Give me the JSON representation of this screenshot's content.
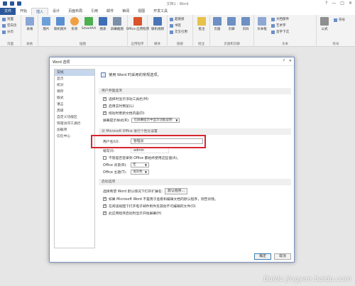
{
  "window": {
    "title": "文档1 - Word",
    "controls": [
      "?",
      "—",
      "□",
      "✕"
    ]
  },
  "ribbon": {
    "tabs": [
      "文件",
      "开始",
      "插入",
      "设计",
      "页面布局",
      "引用",
      "邮件",
      "审阅",
      "视图",
      "开发工具"
    ],
    "active_tab": "插入",
    "groups": [
      {
        "label": "页面",
        "buttons": []
      },
      {
        "label": "表格",
        "buttons": [
          "表格"
        ]
      },
      {
        "label": "插图",
        "buttons": [
          "图片",
          "联机图片",
          "形状",
          "SmartArt",
          "图表",
          "屏幕截图"
        ]
      },
      {
        "label": "应用程序",
        "buttons": [
          "Office 应用程序"
        ]
      },
      {
        "label": "媒体",
        "buttons": [
          "联机视频"
        ]
      },
      {
        "label": "链接",
        "buttons": []
      },
      {
        "label": "批注",
        "buttons": [
          "批注"
        ]
      },
      {
        "label": "页眉和页脚",
        "buttons": [
          "页眉",
          "页脚",
          "页码"
        ]
      },
      {
        "label": "文本",
        "buttons": [
          "文本框"
        ]
      },
      {
        "label": "符号",
        "buttons": [
          "公式"
        ]
      }
    ],
    "page_items": [
      "封面",
      "空白页",
      "分页"
    ],
    "link_items": [
      "超链接",
      "书签",
      "交叉引用"
    ],
    "text_items": [
      "文档部件",
      "艺术字",
      "首字下沉"
    ],
    "symbol_items": [
      "符号"
    ]
  },
  "dialog": {
    "title": "Word 选项",
    "nav": [
      "常规",
      "显示",
      "校对",
      "保存",
      "版式",
      "语言",
      "高级",
      "自定义功能区",
      "快速访问工具栏",
      "加载项",
      "信任中心"
    ],
    "selected_nav": "常规",
    "header": "使用 Word 时采用的常规选项。",
    "sections": {
      "ui": "用户界面选项",
      "personalize": "对 Microsoft Office 进行个性化设置",
      "startup": "启动选项"
    },
    "ui_options": [
      {
        "label": "选择时显示浮动工具栏(M)",
        "checked": true
      },
      {
        "label": "启用实时预览(L)",
        "checked": true
      },
      {
        "label": "拖动时更新文档内容(D)",
        "checked": true
      }
    ],
    "screentip": {
      "label": "屏幕提示样式(R):",
      "value": "在屏幕提示中显示功能说明"
    },
    "username": {
      "label": "用户名(U):",
      "value": "管理员"
    },
    "initials": {
      "label": "缩写(I):",
      "value": "admin"
    },
    "always_use": {
      "label": "不管是否登录到 Office 都始终使用这些值(A)。",
      "checked": false
    },
    "background": {
      "label": "Office 背景(B):",
      "value": "无"
    },
    "theme": {
      "label": "Office 主题(T):",
      "value": "浅灰色"
    },
    "startup": {
      "choose_label": "选择希望 Word 默认情况下打开扩展名:",
      "default_programs_button": "默认程序...",
      "options": [
        {
          "label": "如果 Microsoft Word 不是用于查看和编辑文档的默认程序，则告诉我。",
          "checked": true
        },
        {
          "label": "在阅读视图下打开电子邮件附件及其他不可编辑的文件(O)",
          "checked": true
        },
        {
          "label": "此应用程序启动时显示开始屏幕(H)",
          "checked": true
        }
      ]
    },
    "ok_button": "确定",
    "cancel_button": "取消"
  },
  "watermark": "Baidu jingyan.baidu.com"
}
